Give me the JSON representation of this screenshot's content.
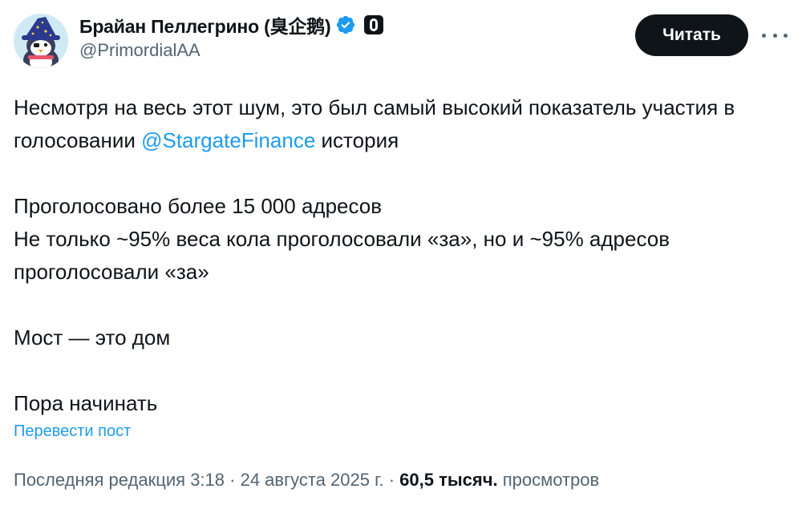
{
  "author": {
    "display_name": "Брайан Пеллегрино (臭企鹅)",
    "handle": "@PrimordialAA"
  },
  "actions": {
    "follow_label": "Читать"
  },
  "icons": {
    "verified": "verified-badge-icon",
    "affiliate": "affiliate-badge-icon",
    "more": "more-options-icon",
    "avatar": "wizard-penguin-avatar"
  },
  "colors": {
    "link": "#1d9bf0",
    "text": "#0f1419",
    "secondary": "#536471",
    "button_bg": "#0f1419"
  },
  "tweet": {
    "para1_prefix": "Несмотря на весь этот шум, это был самый высокий показатель участия в голосовании ",
    "para1_mention": "@StargateFinance",
    "para1_suffix": " история",
    "para2_line1": "Проголосовано более 15 000 адресов",
    "para2_line2": "Не только ~95% веса кола проголосовали «за», но и ~95% адресов проголосовали «за»",
    "para3": "Мост — это дом",
    "para4": "Пора начинать"
  },
  "translate_label": "Перевести пост",
  "meta": {
    "edited_label": "Последняя редакция",
    "time": "3:18",
    "date": "24 августа 2025 г.",
    "views_count": "60,5 тысяч.",
    "views_label": "просмотров"
  }
}
